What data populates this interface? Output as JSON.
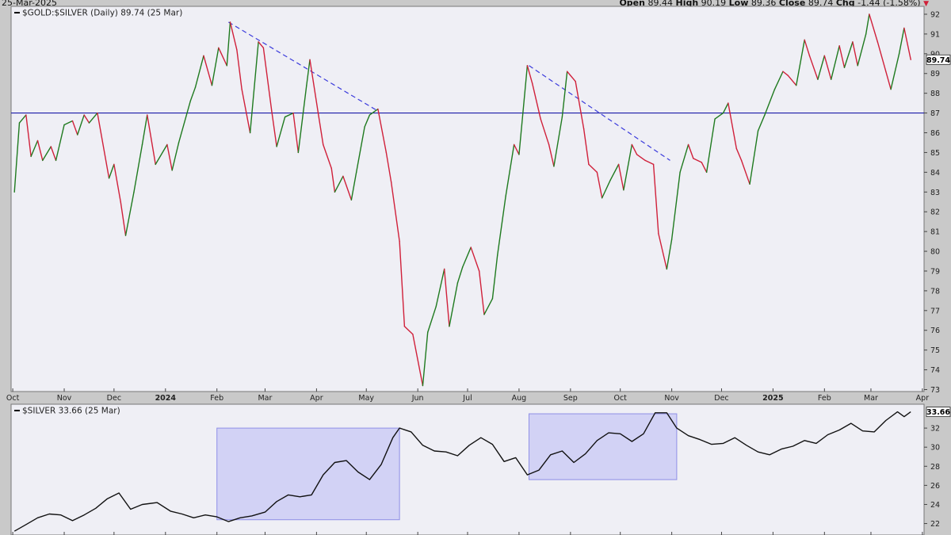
{
  "header": {
    "date": "25-Mar-2025",
    "open_label": "Open",
    "open": "89.44",
    "high_label": "High",
    "high": "90.19",
    "low_label": "Low",
    "low": "89.36",
    "close_label": "Close",
    "close": "89.74",
    "chg_label": "Chg",
    "chg": "-1.44 (-1.58%)",
    "down_arrow": "▼"
  },
  "colors": {
    "up": "#1f7a1f",
    "down": "#d0203a",
    "hline": "#1a1aa8",
    "trend": "#3b3bdc",
    "box_fill": "#c8c8f4",
    "box_stroke": "#8f8fe6",
    "silver_line": "#111111",
    "panel_bg": "#efeff5"
  },
  "chart_data": [
    {
      "type": "line",
      "title": "$GOLD:$SILVER (Daily) 89.74 (25 Mar)",
      "last_value_tag": "89.74",
      "x_ticks": [
        "Oct",
        "Nov",
        "Dec",
        "2024",
        "Feb",
        "Mar",
        "Apr",
        "May",
        "Jun",
        "Jul",
        "Aug",
        "Sep",
        "Oct",
        "Nov",
        "Dec",
        "2025",
        "Feb",
        "Mar",
        "Apr"
      ],
      "y_ticks": [
        "73",
        "74",
        "75",
        "76",
        "77",
        "78",
        "79",
        "80",
        "81",
        "82",
        "83",
        "84",
        "85",
        "86",
        "87",
        "88",
        "89",
        "90",
        "91",
        "92"
      ],
      "ylim": [
        72.9,
        92.4
      ],
      "horizontal_line": 87.0,
      "trendlines": [
        {
          "from": [
            "2024-02-08",
            91.6
          ],
          "to": [
            "2024-05-08",
            87.1
          ]
        },
        {
          "from": [
            "2024-08-07",
            89.4
          ],
          "to": [
            "2024-10-31",
            84.6
          ]
        }
      ],
      "series": [
        {
          "x": "2023-10-02",
          "y": 83.0
        },
        {
          "x": "2023-10-05",
          "y": 86.5
        },
        {
          "x": "2023-10-09",
          "y": 86.9
        },
        {
          "x": "2023-10-12",
          "y": 84.8
        },
        {
          "x": "2023-10-16",
          "y": 85.6
        },
        {
          "x": "2023-10-19",
          "y": 84.6
        },
        {
          "x": "2023-10-24",
          "y": 85.3
        },
        {
          "x": "2023-10-27",
          "y": 84.6
        },
        {
          "x": "2023-11-01",
          "y": 86.4
        },
        {
          "x": "2023-11-06",
          "y": 86.6
        },
        {
          "x": "2023-11-09",
          "y": 85.9
        },
        {
          "x": "2023-11-13",
          "y": 86.9
        },
        {
          "x": "2023-11-16",
          "y": 86.5
        },
        {
          "x": "2023-11-21",
          "y": 87.0
        },
        {
          "x": "2023-11-28",
          "y": 83.7
        },
        {
          "x": "2023-12-01",
          "y": 84.4
        },
        {
          "x": "2023-12-05",
          "y": 82.5
        },
        {
          "x": "2023-12-08",
          "y": 80.8
        },
        {
          "x": "2023-12-13",
          "y": 83.0
        },
        {
          "x": "2023-12-18",
          "y": 85.4
        },
        {
          "x": "2023-12-21",
          "y": 86.9
        },
        {
          "x": "2023-12-26",
          "y": 84.4
        },
        {
          "x": "2024-01-02",
          "y": 85.4
        },
        {
          "x": "2024-01-05",
          "y": 84.1
        },
        {
          "x": "2024-01-09",
          "y": 85.5
        },
        {
          "x": "2024-01-16",
          "y": 87.6
        },
        {
          "x": "2024-01-19",
          "y": 88.3
        },
        {
          "x": "2024-01-24",
          "y": 89.9
        },
        {
          "x": "2024-01-29",
          "y": 88.4
        },
        {
          "x": "2024-02-02",
          "y": 90.3
        },
        {
          "x": "2024-02-07",
          "y": 89.4
        },
        {
          "x": "2024-02-09",
          "y": 91.6
        },
        {
          "x": "2024-02-13",
          "y": 90.2
        },
        {
          "x": "2024-02-16",
          "y": 88.2
        },
        {
          "x": "2024-02-21",
          "y": 86.0
        },
        {
          "x": "2024-02-26",
          "y": 90.6
        },
        {
          "x": "2024-02-29",
          "y": 90.3
        },
        {
          "x": "2024-03-05",
          "y": 87.1
        },
        {
          "x": "2024-03-08",
          "y": 85.3
        },
        {
          "x": "2024-03-13",
          "y": 86.8
        },
        {
          "x": "2024-03-18",
          "y": 87.0
        },
        {
          "x": "2024-03-21",
          "y": 85.0
        },
        {
          "x": "2024-03-26",
          "y": 88.4
        },
        {
          "x": "2024-03-28",
          "y": 89.7
        },
        {
          "x": "2024-04-02",
          "y": 87.0
        },
        {
          "x": "2024-04-05",
          "y": 85.4
        },
        {
          "x": "2024-04-10",
          "y": 84.2
        },
        {
          "x": "2024-04-12",
          "y": 83.0
        },
        {
          "x": "2024-04-17",
          "y": 83.8
        },
        {
          "x": "2024-04-22",
          "y": 82.6
        },
        {
          "x": "2024-04-25",
          "y": 84.0
        },
        {
          "x": "2024-04-30",
          "y": 86.3
        },
        {
          "x": "2024-05-03",
          "y": 86.9
        },
        {
          "x": "2024-05-08",
          "y": 87.2
        },
        {
          "x": "2024-05-13",
          "y": 85.0
        },
        {
          "x": "2024-05-16",
          "y": 83.5
        },
        {
          "x": "2024-05-21",
          "y": 80.5
        },
        {
          "x": "2024-05-24",
          "y": 76.2
        },
        {
          "x": "2024-05-29",
          "y": 75.8
        },
        {
          "x": "2024-06-04",
          "y": 73.2
        },
        {
          "x": "2024-06-07",
          "y": 75.9
        },
        {
          "x": "2024-06-12",
          "y": 77.2
        },
        {
          "x": "2024-06-17",
          "y": 79.1
        },
        {
          "x": "2024-06-20",
          "y": 76.2
        },
        {
          "x": "2024-06-25",
          "y": 78.4
        },
        {
          "x": "2024-06-28",
          "y": 79.2
        },
        {
          "x": "2024-07-03",
          "y": 80.2
        },
        {
          "x": "2024-07-08",
          "y": 79.0
        },
        {
          "x": "2024-07-11",
          "y": 76.8
        },
        {
          "x": "2024-07-16",
          "y": 77.6
        },
        {
          "x": "2024-07-19",
          "y": 79.8
        },
        {
          "x": "2024-07-24",
          "y": 82.8
        },
        {
          "x": "2024-07-29",
          "y": 85.4
        },
        {
          "x": "2024-08-01",
          "y": 84.9
        },
        {
          "x": "2024-08-06",
          "y": 89.4
        },
        {
          "x": "2024-08-09",
          "y": 88.5
        },
        {
          "x": "2024-08-14",
          "y": 86.7
        },
        {
          "x": "2024-08-19",
          "y": 85.4
        },
        {
          "x": "2024-08-22",
          "y": 84.3
        },
        {
          "x": "2024-08-27",
          "y": 86.8
        },
        {
          "x": "2024-08-30",
          "y": 89.1
        },
        {
          "x": "2024-09-04",
          "y": 88.6
        },
        {
          "x": "2024-09-09",
          "y": 86.2
        },
        {
          "x": "2024-09-12",
          "y": 84.4
        },
        {
          "x": "2024-09-17",
          "y": 84.0
        },
        {
          "x": "2024-09-20",
          "y": 82.7
        },
        {
          "x": "2024-09-25",
          "y": 83.6
        },
        {
          "x": "2024-09-30",
          "y": 84.4
        },
        {
          "x": "2024-10-03",
          "y": 83.1
        },
        {
          "x": "2024-10-08",
          "y": 85.4
        },
        {
          "x": "2024-10-11",
          "y": 84.9
        },
        {
          "x": "2024-10-16",
          "y": 84.6
        },
        {
          "x": "2024-10-21",
          "y": 84.4
        },
        {
          "x": "2024-10-24",
          "y": 80.9
        },
        {
          "x": "2024-10-29",
          "y": 79.1
        },
        {
          "x": "2024-11-01",
          "y": 80.6
        },
        {
          "x": "2024-11-06",
          "y": 84.0
        },
        {
          "x": "2024-11-11",
          "y": 85.4
        },
        {
          "x": "2024-11-14",
          "y": 84.7
        },
        {
          "x": "2024-11-19",
          "y": 84.5
        },
        {
          "x": "2024-11-22",
          "y": 84.0
        },
        {
          "x": "2024-11-27",
          "y": 86.7
        },
        {
          "x": "2024-12-02",
          "y": 87.0
        },
        {
          "x": "2024-12-05",
          "y": 87.5
        },
        {
          "x": "2024-12-10",
          "y": 85.2
        },
        {
          "x": "2024-12-13",
          "y": 84.6
        },
        {
          "x": "2024-12-18",
          "y": 83.4
        },
        {
          "x": "2024-12-23",
          "y": 86.1
        },
        {
          "x": "2024-12-27",
          "y": 86.9
        },
        {
          "x": "2025-01-02",
          "y": 88.2
        },
        {
          "x": "2025-01-07",
          "y": 89.1
        },
        {
          "x": "2025-01-10",
          "y": 88.9
        },
        {
          "x": "2025-01-15",
          "y": 88.4
        },
        {
          "x": "2025-01-20",
          "y": 90.7
        },
        {
          "x": "2025-01-23",
          "y": 89.9
        },
        {
          "x": "2025-01-28",
          "y": 88.7
        },
        {
          "x": "2025-02-01",
          "y": 89.9
        },
        {
          "x": "2025-02-05",
          "y": 88.7
        },
        {
          "x": "2025-02-10",
          "y": 90.4
        },
        {
          "x": "2025-02-13",
          "y": 89.3
        },
        {
          "x": "2025-02-18",
          "y": 90.6
        },
        {
          "x": "2025-02-21",
          "y": 89.4
        },
        {
          "x": "2025-02-26",
          "y": 91.0
        },
        {
          "x": "2025-02-28",
          "y": 92.0
        },
        {
          "x": "2025-03-05",
          "y": 90.6
        },
        {
          "x": "2025-03-10",
          "y": 89.1
        },
        {
          "x": "2025-03-13",
          "y": 88.2
        },
        {
          "x": "2025-03-18",
          "y": 90.0
        },
        {
          "x": "2025-03-21",
          "y": 91.3
        },
        {
          "x": "2025-03-25",
          "y": 89.7
        }
      ]
    },
    {
      "type": "line",
      "title": "$SILVER 33.66 (25 Mar)",
      "last_value_tag": "33.66",
      "y_ticks": [
        "22",
        "24",
        "26",
        "28",
        "30",
        "32"
      ],
      "ylim": [
        20.8,
        34.5
      ],
      "highlight_boxes": [
        {
          "from": "2024-02-01",
          "to": "2024-05-21",
          "ylim": [
            22.4,
            32.0
          ]
        },
        {
          "from": "2024-08-07",
          "to": "2024-11-04",
          "ylim": [
            26.6,
            33.5
          ]
        }
      ],
      "series": [
        {
          "x": "2023-10-02",
          "y": 21.2
        },
        {
          "x": "2023-10-09",
          "y": 21.9
        },
        {
          "x": "2023-10-16",
          "y": 22.6
        },
        {
          "x": "2023-10-23",
          "y": 23.0
        },
        {
          "x": "2023-10-30",
          "y": 22.9
        },
        {
          "x": "2023-11-06",
          "y": 22.3
        },
        {
          "x": "2023-11-13",
          "y": 22.9
        },
        {
          "x": "2023-11-20",
          "y": 23.6
        },
        {
          "x": "2023-11-27",
          "y": 24.6
        },
        {
          "x": "2023-12-04",
          "y": 25.2
        },
        {
          "x": "2023-12-11",
          "y": 23.5
        },
        {
          "x": "2023-12-18",
          "y": 24.0
        },
        {
          "x": "2023-12-27",
          "y": 24.2
        },
        {
          "x": "2024-01-04",
          "y": 23.3
        },
        {
          "x": "2024-01-11",
          "y": 23.0
        },
        {
          "x": "2024-01-18",
          "y": 22.6
        },
        {
          "x": "2024-01-25",
          "y": 22.9
        },
        {
          "x": "2024-02-01",
          "y": 22.7
        },
        {
          "x": "2024-02-08",
          "y": 22.2
        },
        {
          "x": "2024-02-15",
          "y": 22.6
        },
        {
          "x": "2024-02-22",
          "y": 22.8
        },
        {
          "x": "2024-03-01",
          "y": 23.2
        },
        {
          "x": "2024-03-08",
          "y": 24.3
        },
        {
          "x": "2024-03-15",
          "y": 25.0
        },
        {
          "x": "2024-03-22",
          "y": 24.8
        },
        {
          "x": "2024-03-29",
          "y": 25.0
        },
        {
          "x": "2024-04-05",
          "y": 27.1
        },
        {
          "x": "2024-04-12",
          "y": 28.4
        },
        {
          "x": "2024-04-19",
          "y": 28.6
        },
        {
          "x": "2024-04-26",
          "y": 27.4
        },
        {
          "x": "2024-05-03",
          "y": 26.6
        },
        {
          "x": "2024-05-10",
          "y": 28.2
        },
        {
          "x": "2024-05-17",
          "y": 31.0
        },
        {
          "x": "2024-05-21",
          "y": 32.0
        },
        {
          "x": "2024-05-28",
          "y": 31.6
        },
        {
          "x": "2024-06-04",
          "y": 30.2
        },
        {
          "x": "2024-06-11",
          "y": 29.6
        },
        {
          "x": "2024-06-18",
          "y": 29.5
        },
        {
          "x": "2024-06-25",
          "y": 29.1
        },
        {
          "x": "2024-07-02",
          "y": 30.2
        },
        {
          "x": "2024-07-09",
          "y": 31.0
        },
        {
          "x": "2024-07-16",
          "y": 30.3
        },
        {
          "x": "2024-07-23",
          "y": 28.5
        },
        {
          "x": "2024-07-30",
          "y": 28.9
        },
        {
          "x": "2024-08-06",
          "y": 27.1
        },
        {
          "x": "2024-08-13",
          "y": 27.6
        },
        {
          "x": "2024-08-20",
          "y": 29.2
        },
        {
          "x": "2024-08-27",
          "y": 29.6
        },
        {
          "x": "2024-09-03",
          "y": 28.4
        },
        {
          "x": "2024-09-10",
          "y": 29.3
        },
        {
          "x": "2024-09-17",
          "y": 30.7
        },
        {
          "x": "2024-09-24",
          "y": 31.5
        },
        {
          "x": "2024-10-01",
          "y": 31.4
        },
        {
          "x": "2024-10-08",
          "y": 30.6
        },
        {
          "x": "2024-10-15",
          "y": 31.4
        },
        {
          "x": "2024-10-22",
          "y": 33.6
        },
        {
          "x": "2024-10-29",
          "y": 33.6
        },
        {
          "x": "2024-11-04",
          "y": 32.0
        },
        {
          "x": "2024-11-11",
          "y": 31.2
        },
        {
          "x": "2024-11-18",
          "y": 30.8
        },
        {
          "x": "2024-11-25",
          "y": 30.3
        },
        {
          "x": "2024-12-02",
          "y": 30.4
        },
        {
          "x": "2024-12-09",
          "y": 31.0
        },
        {
          "x": "2024-12-16",
          "y": 30.2
        },
        {
          "x": "2024-12-23",
          "y": 29.5
        },
        {
          "x": "2024-12-30",
          "y": 29.2
        },
        {
          "x": "2025-01-06",
          "y": 29.8
        },
        {
          "x": "2025-01-13",
          "y": 30.1
        },
        {
          "x": "2025-01-20",
          "y": 30.7
        },
        {
          "x": "2025-01-27",
          "y": 30.4
        },
        {
          "x": "2025-02-03",
          "y": 31.3
        },
        {
          "x": "2025-02-10",
          "y": 31.8
        },
        {
          "x": "2025-02-17",
          "y": 32.5
        },
        {
          "x": "2025-02-24",
          "y": 31.7
        },
        {
          "x": "2025-03-03",
          "y": 31.6
        },
        {
          "x": "2025-03-10",
          "y": 32.8
        },
        {
          "x": "2025-03-17",
          "y": 33.7
        },
        {
          "x": "2025-03-21",
          "y": 33.2
        },
        {
          "x": "2025-03-25",
          "y": 33.7
        }
      ]
    }
  ]
}
